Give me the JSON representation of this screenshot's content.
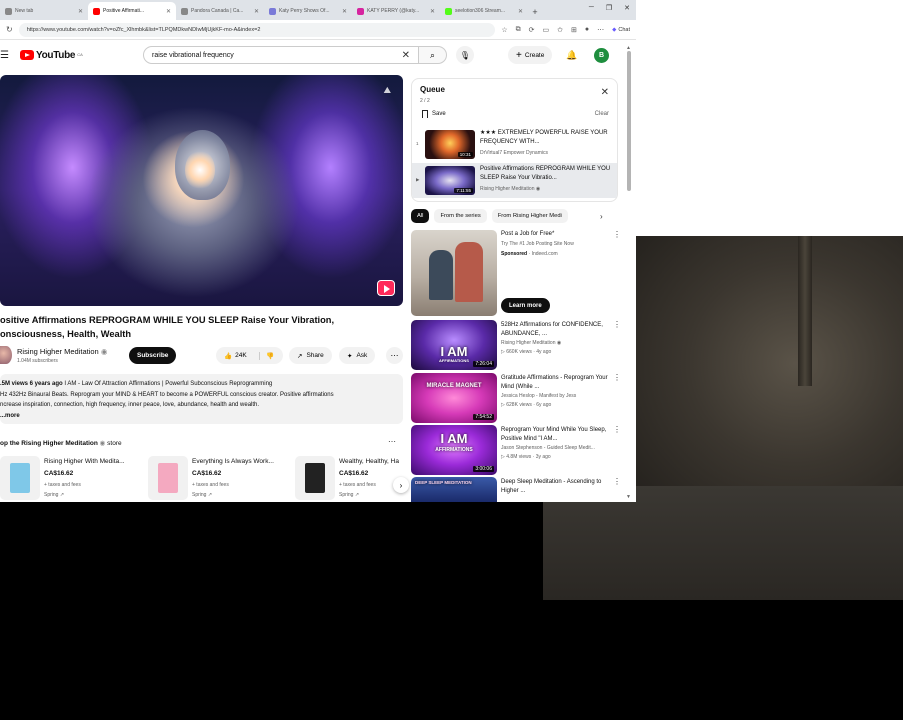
{
  "browser": {
    "tabs": [
      {
        "label": "New tab",
        "active": false
      },
      {
        "label": "Positive Affirmati...",
        "active": true
      },
      {
        "label": "Pandora Canada | Ca...",
        "active": false
      },
      {
        "label": "Katy Perry Shows Of...",
        "active": false
      },
      {
        "label": "KATY PERRY (@katy...",
        "active": false
      },
      {
        "label": "seelotion306 Stream...",
        "active": false
      }
    ],
    "url": "https://www.youtube.com/watch?v=oZfc_Xlhmbk&list=TLPQMDkwNDIwMjUjkKF-mo-A&index=2",
    "chat_label": "Chat"
  },
  "youtube": {
    "logo_text": "YouTube",
    "logo_region": "CA",
    "search_value": "raise vibrational frequency",
    "create_label": "Create",
    "avatar_letter": "B"
  },
  "video": {
    "title_line1": "ositive Affirmations REPROGRAM WHILE YOU SLEEP Raise Your Vibration,",
    "title_line2": "onsciousness, Health, Wealth",
    "channel": "Rising Higher Meditation",
    "subscribers": "1.04M subscribers",
    "subscribe_label": "Subscribe",
    "likes": "24K",
    "share_label": "Share",
    "ask_label": "Ask",
    "desc_meta": ".5M views  6 years ago",
    "desc_line1": " I AM - Law Of Attraction Affirmations | Powerful Subconscious Reprogramming",
    "desc_line2": "Hz 432Hz Binaural Beats. Reprogram your MIND & HEART to become a POWERFUL conscious creator. Positive affirmations",
    "desc_line3": "ncrease inspiration, connection, high frequency, inner peace, love, abundance, health and wealth.",
    "desc_more": "...more"
  },
  "store": {
    "heading": "op the Rising Higher Meditation",
    "heading_suffix": "store",
    "products": [
      {
        "name": "Rising Higher With Medita...",
        "price": "CA$16.62",
        "tax": "+ taxes and fees",
        "shop": "Spring",
        "color": "#7fc8e8"
      },
      {
        "name": "Everything Is Always Work...",
        "price": "CA$16.62",
        "tax": "+ taxes and fees",
        "shop": "Spring",
        "color": "#f4a9c0"
      },
      {
        "name": "Wealthy, Healthy, Ha",
        "price": "CA$16.62",
        "tax": "+ taxes and fees",
        "shop": "Spring",
        "color": "#222222"
      }
    ]
  },
  "queue": {
    "title": "Queue",
    "count": "2 / 2",
    "save_label": "Save",
    "clear_label": "Clear",
    "items": [
      {
        "index": "1",
        "title": "★★★ EXTREMELY POWERFUL RAISE YOUR FREQUENCY WITH...",
        "channel": "DrVirtual7 Empower Dynamics",
        "duration": "10:31",
        "active": false
      },
      {
        "index": "▶",
        "title": "Positive Affirmations REPROGRAM WHILE YOU SLEEP Raise Your Vibratio...",
        "channel": "Rising Higher Meditation",
        "duration": "7:11:55",
        "active": true
      }
    ]
  },
  "chips": [
    "All",
    "From the series",
    "From Rising Higher Medi"
  ],
  "ad": {
    "title": "Post a Job for Free*",
    "desc": "Try The #1 Job Posting Site Now",
    "sponsored": "Sponsored",
    "domain": " · Indeed.com",
    "cta": "Learn more"
  },
  "recommendations": [
    {
      "title": "528Hz Affirmations for CONFIDENCE, ABUNDANCE, ...",
      "channel": "Rising Higher Meditation",
      "views": "660K views · 4y ago",
      "duration": "7:26:04",
      "thumb_text": "I AM",
      "thumb_sub": "AFFIRMATIONS"
    },
    {
      "title": "Gratitude Affirmations - Reprogram Your Mind (While ...",
      "channel": "Jessica Heslop - Manifest by Jess",
      "views": "628K views · 6y ago",
      "duration": "7:54:52",
      "thumb_text": "MIRACLE MAGNET",
      "thumb_sub": ""
    },
    {
      "title": "Reprogram Your Mind While You Sleep, Positive Mind \"I AM...",
      "channel": "Jason Stephenson - Guided Sleep Medit...",
      "views": "4.8M views · 3y ago",
      "duration": "3:00:06",
      "thumb_text": "I AM",
      "thumb_sub": "AFFIRMATIONS"
    },
    {
      "title": "Deep Sleep Meditation - Ascending to Higher ...",
      "channel": "",
      "views": "",
      "duration": "",
      "thumb_text": "DEEP SLEEP MEDITATION",
      "thumb_sub": ""
    }
  ]
}
